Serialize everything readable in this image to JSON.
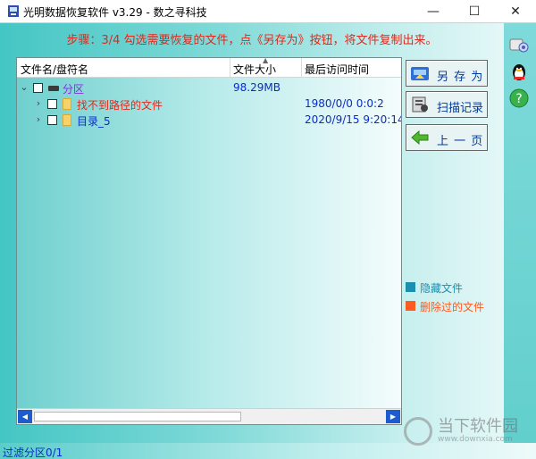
{
  "window": {
    "title": "光明数据恢复软件 v3.29 - 数之寻科技",
    "minimize_icon": "—",
    "maximize_icon": "☐",
    "close_icon": "✕"
  },
  "step_text": "步骤：3/4 勾选需要恢复的文件，点《另存为》按钮，将文件复制出来。",
  "columns": {
    "name": "文件名/盘符名",
    "size": "文件大小",
    "time": "最后访问时间"
  },
  "tree": [
    {
      "name": "分区",
      "size": "98.29MB",
      "time": "",
      "expander": "⌄",
      "color": "#8a2be2",
      "type": "drive"
    },
    {
      "name": "找不到路径的文件",
      "size": "",
      "time": "1980/0/0 0:0:2",
      "expander": "›",
      "color": "#e0281c",
      "type": "folder"
    },
    {
      "name": "目录_5",
      "size": "",
      "time": "2020/9/15 9:20:14",
      "expander": "›",
      "color": "#0a2dc8",
      "type": "folder"
    }
  ],
  "buttons": {
    "save_as": "另 存 为",
    "scan_record": "扫描记录",
    "back": "上 一 页"
  },
  "legend": {
    "hidden": {
      "label": "隐藏文件",
      "color": "#1b8fb0"
    },
    "deleted": {
      "label": "删除过的文件",
      "color": "#ff5a1f"
    }
  },
  "status": "过滤分区0/1",
  "watermark": {
    "title": "当下软件园",
    "url": "www.downxia.com"
  },
  "scroll": {
    "left": "◀",
    "right": "▶"
  }
}
